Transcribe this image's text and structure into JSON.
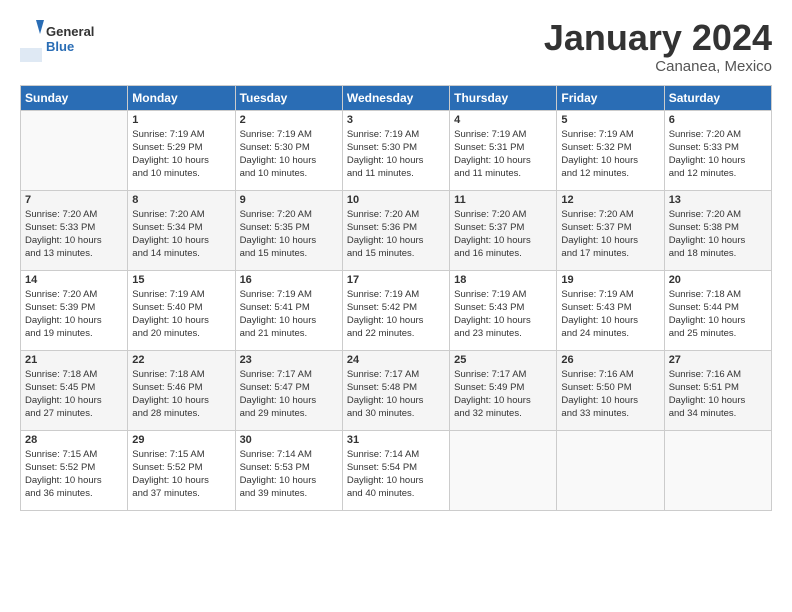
{
  "header": {
    "logo_general": "General",
    "logo_blue": "Blue",
    "month_title": "January 2024",
    "location": "Cananea, Mexico"
  },
  "weekdays": [
    "Sunday",
    "Monday",
    "Tuesday",
    "Wednesday",
    "Thursday",
    "Friday",
    "Saturday"
  ],
  "weeks": [
    [
      {
        "day": "",
        "info": ""
      },
      {
        "day": "1",
        "info": "Sunrise: 7:19 AM\nSunset: 5:29 PM\nDaylight: 10 hours\nand 10 minutes."
      },
      {
        "day": "2",
        "info": "Sunrise: 7:19 AM\nSunset: 5:30 PM\nDaylight: 10 hours\nand 10 minutes."
      },
      {
        "day": "3",
        "info": "Sunrise: 7:19 AM\nSunset: 5:30 PM\nDaylight: 10 hours\nand 11 minutes."
      },
      {
        "day": "4",
        "info": "Sunrise: 7:19 AM\nSunset: 5:31 PM\nDaylight: 10 hours\nand 11 minutes."
      },
      {
        "day": "5",
        "info": "Sunrise: 7:19 AM\nSunset: 5:32 PM\nDaylight: 10 hours\nand 12 minutes."
      },
      {
        "day": "6",
        "info": "Sunrise: 7:20 AM\nSunset: 5:33 PM\nDaylight: 10 hours\nand 12 minutes."
      }
    ],
    [
      {
        "day": "7",
        "info": "Sunrise: 7:20 AM\nSunset: 5:33 PM\nDaylight: 10 hours\nand 13 minutes."
      },
      {
        "day": "8",
        "info": "Sunrise: 7:20 AM\nSunset: 5:34 PM\nDaylight: 10 hours\nand 14 minutes."
      },
      {
        "day": "9",
        "info": "Sunrise: 7:20 AM\nSunset: 5:35 PM\nDaylight: 10 hours\nand 15 minutes."
      },
      {
        "day": "10",
        "info": "Sunrise: 7:20 AM\nSunset: 5:36 PM\nDaylight: 10 hours\nand 15 minutes."
      },
      {
        "day": "11",
        "info": "Sunrise: 7:20 AM\nSunset: 5:37 PM\nDaylight: 10 hours\nand 16 minutes."
      },
      {
        "day": "12",
        "info": "Sunrise: 7:20 AM\nSunset: 5:37 PM\nDaylight: 10 hours\nand 17 minutes."
      },
      {
        "day": "13",
        "info": "Sunrise: 7:20 AM\nSunset: 5:38 PM\nDaylight: 10 hours\nand 18 minutes."
      }
    ],
    [
      {
        "day": "14",
        "info": "Sunrise: 7:20 AM\nSunset: 5:39 PM\nDaylight: 10 hours\nand 19 minutes."
      },
      {
        "day": "15",
        "info": "Sunrise: 7:19 AM\nSunset: 5:40 PM\nDaylight: 10 hours\nand 20 minutes."
      },
      {
        "day": "16",
        "info": "Sunrise: 7:19 AM\nSunset: 5:41 PM\nDaylight: 10 hours\nand 21 minutes."
      },
      {
        "day": "17",
        "info": "Sunrise: 7:19 AM\nSunset: 5:42 PM\nDaylight: 10 hours\nand 22 minutes."
      },
      {
        "day": "18",
        "info": "Sunrise: 7:19 AM\nSunset: 5:43 PM\nDaylight: 10 hours\nand 23 minutes."
      },
      {
        "day": "19",
        "info": "Sunrise: 7:19 AM\nSunset: 5:43 PM\nDaylight: 10 hours\nand 24 minutes."
      },
      {
        "day": "20",
        "info": "Sunrise: 7:18 AM\nSunset: 5:44 PM\nDaylight: 10 hours\nand 25 minutes."
      }
    ],
    [
      {
        "day": "21",
        "info": "Sunrise: 7:18 AM\nSunset: 5:45 PM\nDaylight: 10 hours\nand 27 minutes."
      },
      {
        "day": "22",
        "info": "Sunrise: 7:18 AM\nSunset: 5:46 PM\nDaylight: 10 hours\nand 28 minutes."
      },
      {
        "day": "23",
        "info": "Sunrise: 7:17 AM\nSunset: 5:47 PM\nDaylight: 10 hours\nand 29 minutes."
      },
      {
        "day": "24",
        "info": "Sunrise: 7:17 AM\nSunset: 5:48 PM\nDaylight: 10 hours\nand 30 minutes."
      },
      {
        "day": "25",
        "info": "Sunrise: 7:17 AM\nSunset: 5:49 PM\nDaylight: 10 hours\nand 32 minutes."
      },
      {
        "day": "26",
        "info": "Sunrise: 7:16 AM\nSunset: 5:50 PM\nDaylight: 10 hours\nand 33 minutes."
      },
      {
        "day": "27",
        "info": "Sunrise: 7:16 AM\nSunset: 5:51 PM\nDaylight: 10 hours\nand 34 minutes."
      }
    ],
    [
      {
        "day": "28",
        "info": "Sunrise: 7:15 AM\nSunset: 5:52 PM\nDaylight: 10 hours\nand 36 minutes."
      },
      {
        "day": "29",
        "info": "Sunrise: 7:15 AM\nSunset: 5:52 PM\nDaylight: 10 hours\nand 37 minutes."
      },
      {
        "day": "30",
        "info": "Sunrise: 7:14 AM\nSunset: 5:53 PM\nDaylight: 10 hours\nand 39 minutes."
      },
      {
        "day": "31",
        "info": "Sunrise: 7:14 AM\nSunset: 5:54 PM\nDaylight: 10 hours\nand 40 minutes."
      },
      {
        "day": "",
        "info": ""
      },
      {
        "day": "",
        "info": ""
      },
      {
        "day": "",
        "info": ""
      }
    ]
  ]
}
